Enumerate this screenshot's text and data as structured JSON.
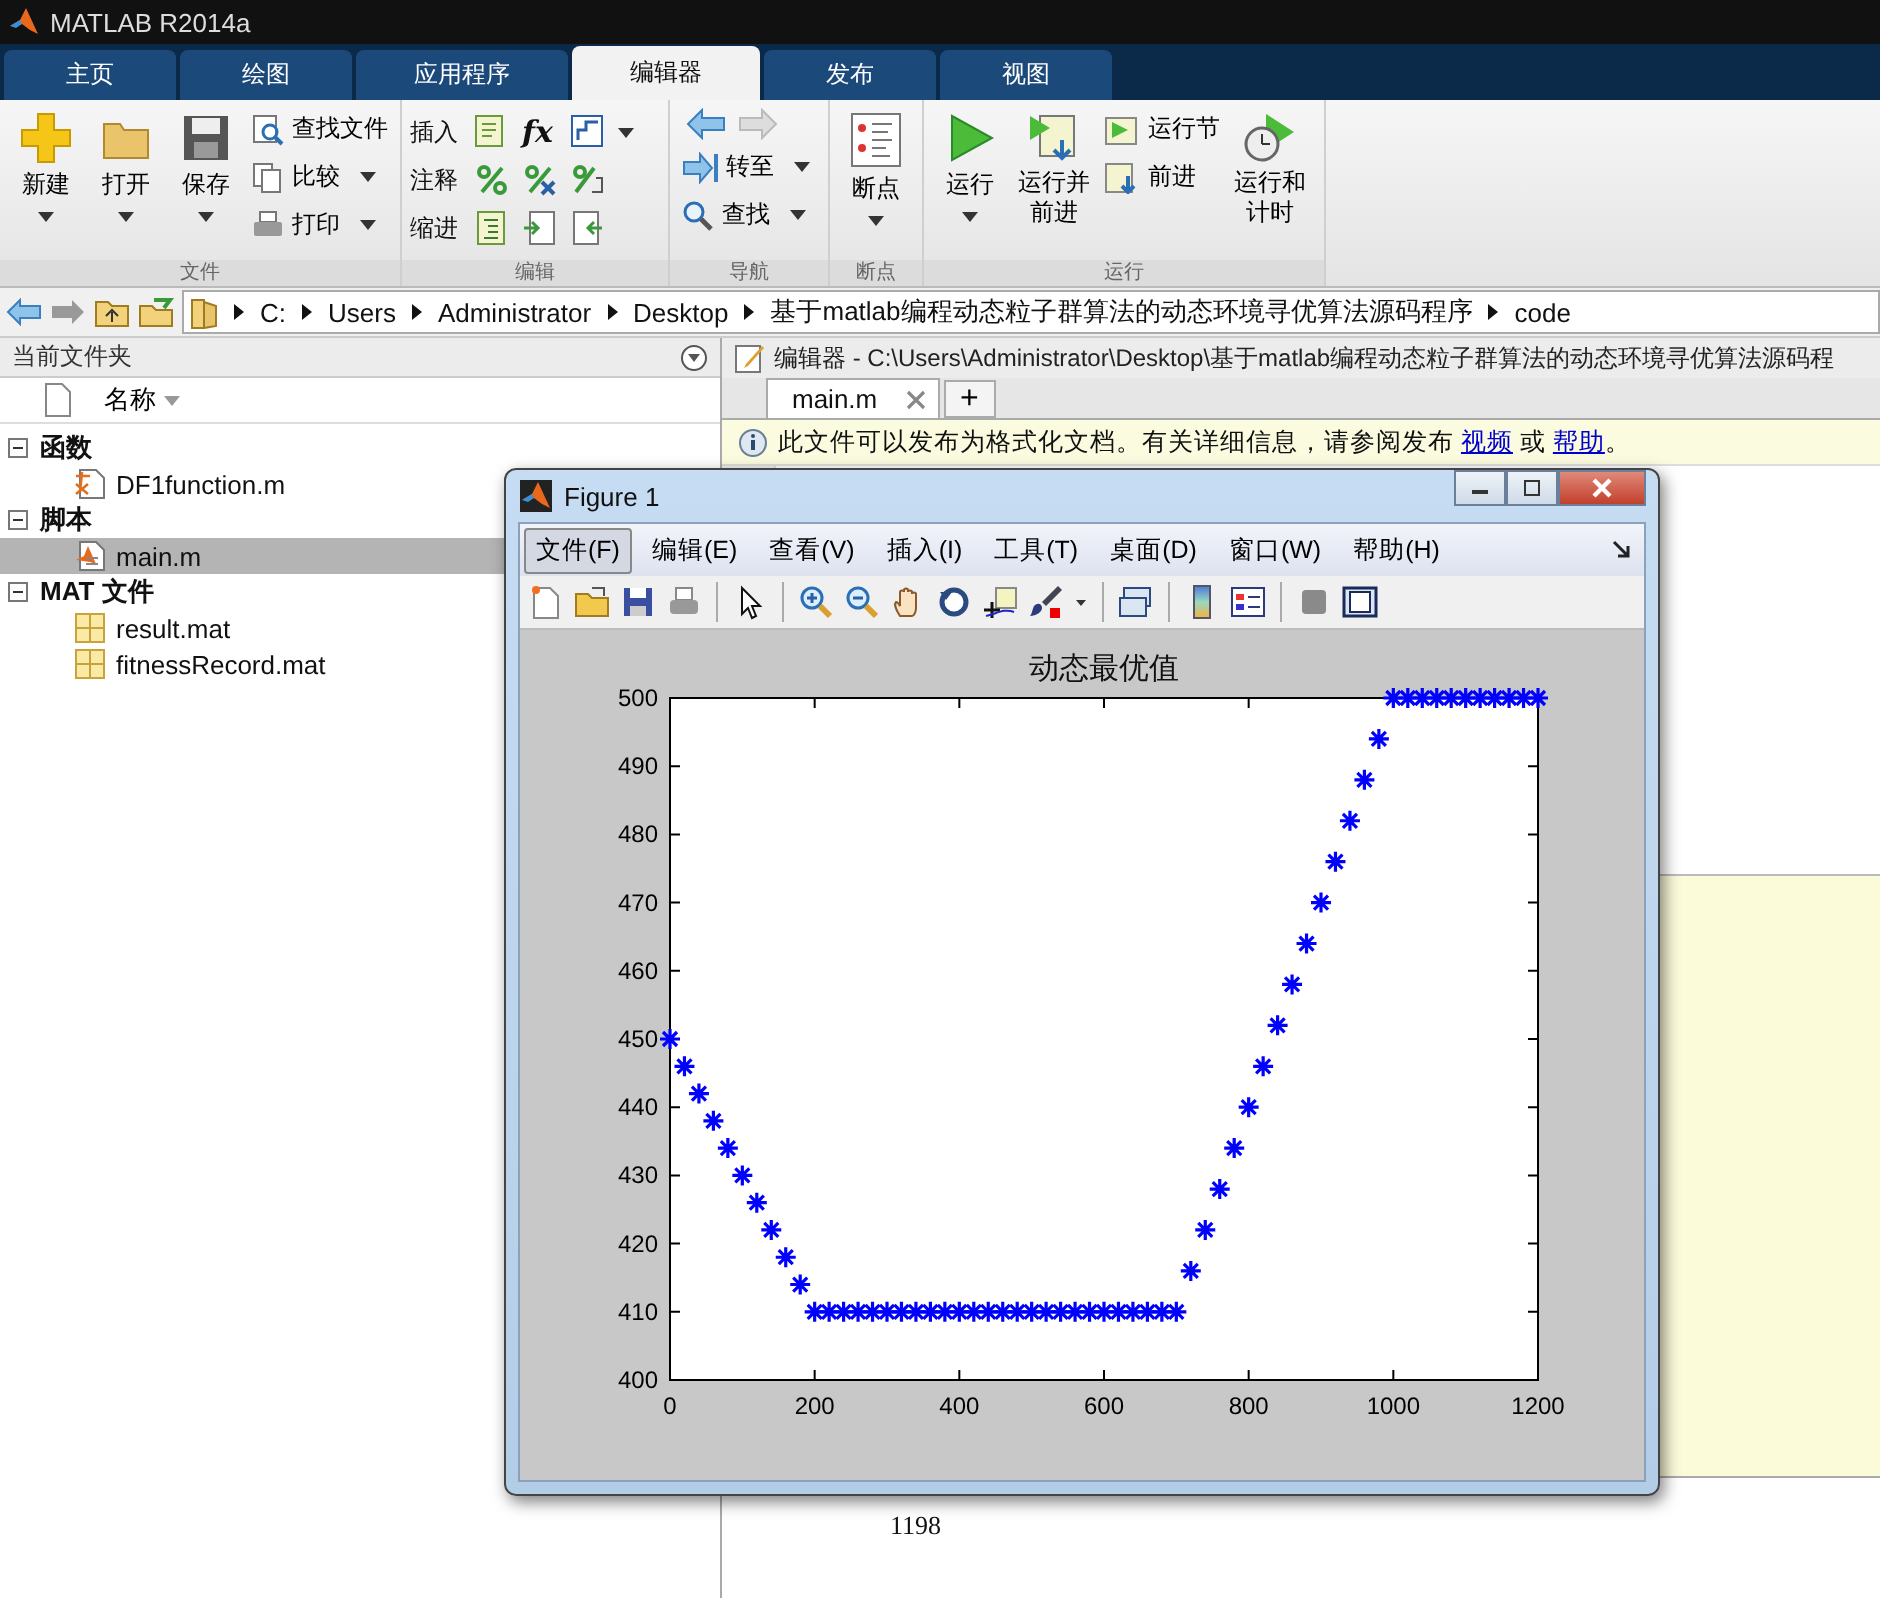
{
  "app": {
    "title": "MATLAB R2014a"
  },
  "tabs": [
    {
      "label": "主页",
      "selected": false
    },
    {
      "label": "绘图",
      "selected": false
    },
    {
      "label": "应用程序",
      "selected": false
    },
    {
      "label": "编辑器",
      "selected": true
    },
    {
      "label": "发布",
      "selected": false
    },
    {
      "label": "视图",
      "selected": false
    }
  ],
  "ribbon": {
    "file": {
      "label": "文件",
      "new": "新建",
      "open": "打开",
      "save": "保存",
      "find_files": "查找文件",
      "compare": "比较",
      "print": "打印"
    },
    "edit": {
      "label": "编辑",
      "insert": "插入",
      "comment": "注释",
      "indent": "缩进",
      "function_glyph": "fx"
    },
    "navigate": {
      "label": "导航",
      "go_to": "转至",
      "find": "查找"
    },
    "breakpoints": {
      "label": "断点",
      "button": "断点"
    },
    "run": {
      "label": "运行",
      "run": "运行",
      "run_advance": [
        "运行并",
        "前进"
      ],
      "run_section": "运行节",
      "advance": "前进",
      "run_time": [
        "运行和",
        "计时"
      ]
    }
  },
  "address": {
    "segments": [
      "C:",
      "Users",
      "Administrator",
      "Desktop",
      "基于matlab编程动态粒子群算法的动态环境寻优算法源码程序",
      "code"
    ]
  },
  "file_browser": {
    "title": "当前文件夹",
    "column": "名称",
    "groups": [
      {
        "label": "函数",
        "expanded": true,
        "children": [
          {
            "name": "DF1function.m",
            "kind": "function",
            "selected": false
          }
        ]
      },
      {
        "label": "脚本",
        "expanded": true,
        "children": [
          {
            "name": "main.m",
            "kind": "script",
            "selected": true
          }
        ]
      },
      {
        "label": "MAT 文件",
        "expanded": true,
        "children": [
          {
            "name": "result.mat",
            "kind": "mat",
            "selected": false
          },
          {
            "name": "fitnessRecord.mat",
            "kind": "mat",
            "selected": false
          }
        ]
      }
    ]
  },
  "editor": {
    "title": "编辑器 - C:\\Users\\Administrator\\Desktop\\基于matlab编程动态粒子群算法的动态环境寻优算法源码程",
    "tab": "main.m",
    "add_tab": "+",
    "notice": {
      "text": "此文件可以发布为格式化文档。有关详细信息，请参阅发布",
      "link_1": "视频",
      "middle": "或",
      "link_2": "帮助",
      "end": "。"
    }
  },
  "command_window": {
    "output": "1198"
  },
  "figure": {
    "title": "Figure 1",
    "menu": [
      {
        "label": "文件(F)",
        "selected": true
      },
      {
        "label": "编辑(E)",
        "selected": false
      },
      {
        "label": "查看(V)",
        "selected": false
      },
      {
        "label": "插入(I)",
        "selected": false
      },
      {
        "label": "工具(T)",
        "selected": false
      },
      {
        "label": "桌面(D)",
        "selected": false
      },
      {
        "label": "窗口(W)",
        "selected": false
      },
      {
        "label": "帮助(H)",
        "selected": false
      }
    ],
    "chart_data": {
      "type": "scatter",
      "title": "动态最优值",
      "x": [
        0,
        20,
        40,
        60,
        80,
        100,
        120,
        140,
        160,
        180,
        200,
        220,
        240,
        260,
        280,
        300,
        320,
        340,
        360,
        380,
        400,
        420,
        440,
        460,
        480,
        500,
        520,
        540,
        560,
        580,
        600,
        620,
        640,
        660,
        680,
        700,
        720,
        740,
        760,
        780,
        800,
        820,
        840,
        860,
        880,
        900,
        920,
        940,
        960,
        980,
        1000,
        1020,
        1040,
        1060,
        1080,
        1100,
        1120,
        1140,
        1160,
        1180,
        1200
      ],
      "series": [
        {
          "color": "#0000ff",
          "values": [
            450,
            446,
            442,
            438,
            434,
            430,
            426,
            422,
            418,
            414,
            410,
            410,
            410,
            410,
            410,
            410,
            410,
            410,
            410,
            410,
            410,
            410,
            410,
            410,
            410,
            410,
            410,
            410,
            410,
            410,
            410,
            410,
            410,
            410,
            410,
            410,
            416,
            422,
            428,
            434,
            440,
            446,
            452,
            458,
            464,
            470,
            476,
            482,
            488,
            494,
            500,
            500,
            500,
            500,
            500,
            500,
            500,
            500,
            500,
            500,
            500
          ]
        }
      ],
      "xlim": [
        0,
        1200
      ],
      "ylim": [
        400,
        500
      ],
      "xticks": [
        0,
        200,
        400,
        600,
        800,
        1000,
        1200
      ],
      "yticks": [
        400,
        410,
        420,
        430,
        440,
        450,
        460,
        470,
        480,
        490,
        500
      ]
    }
  }
}
